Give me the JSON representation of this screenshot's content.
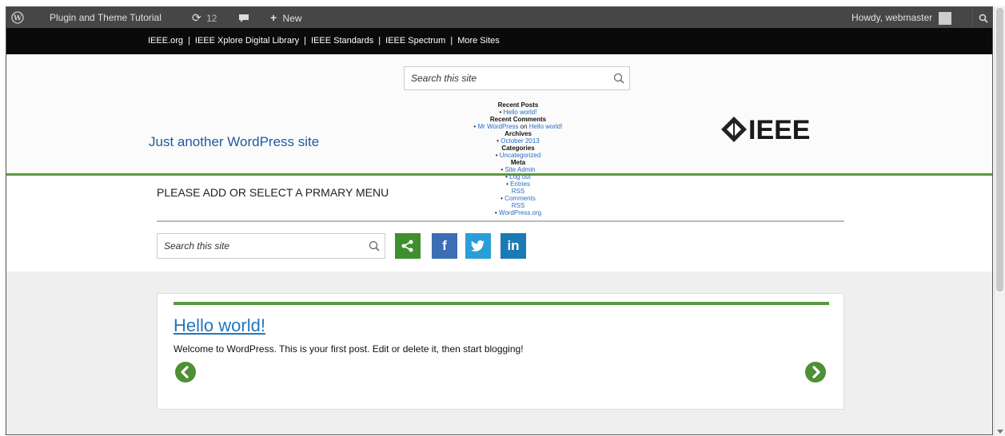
{
  "adminbar": {
    "site_name": "Plugin and Theme Tutorial",
    "updates_count": "12",
    "new_label": "New",
    "howdy": "Howdy, webmaster"
  },
  "ieeebar": {
    "links": [
      "IEEE.org",
      "IEEE Xplore Digital Library",
      "IEEE Standards",
      "IEEE Spectrum",
      "More Sites"
    ]
  },
  "header": {
    "search_placeholder": "Search this site",
    "tagline": "Just another WordPress site",
    "logo_text": "IEEE"
  },
  "widgets": {
    "recent_posts_heading": "Recent Posts",
    "recent_post_1": "Hello world!",
    "recent_comments_heading": "Recent Comments",
    "comment_author": "Mr WordPress",
    "comment_on": "on",
    "comment_post": "Hello world!",
    "archives_heading": "Archives",
    "archive_1": "October 2013",
    "categories_heading": "Categories",
    "category_1": "Uncategorized",
    "meta_heading": "Meta",
    "meta_1": "Site Admin",
    "meta_2": "Log out",
    "meta_3a": "Entries",
    "meta_3b": "RSS",
    "meta_4a": "Comments",
    "meta_4b": "RSS",
    "meta_5": "WordPress.org"
  },
  "menu": {
    "primary_menu_text": "PLEASE ADD OR SELECT A PRMARY MENU",
    "search_placeholder": "Search this site"
  },
  "social": {
    "facebook": "f",
    "linkedin": "in"
  },
  "post": {
    "title": "Hello world!",
    "body": "Welcome to WordPress. This is your first post. Edit or delete it, then start blogging!"
  },
  "colors": {
    "green": "#5a9a3e",
    "share_green": "#3f8f2f",
    "facebook_blue": "#3b6eb3",
    "twitter_blue": "#2a9ed8",
    "linkedin_blue": "#1b7ab4"
  }
}
